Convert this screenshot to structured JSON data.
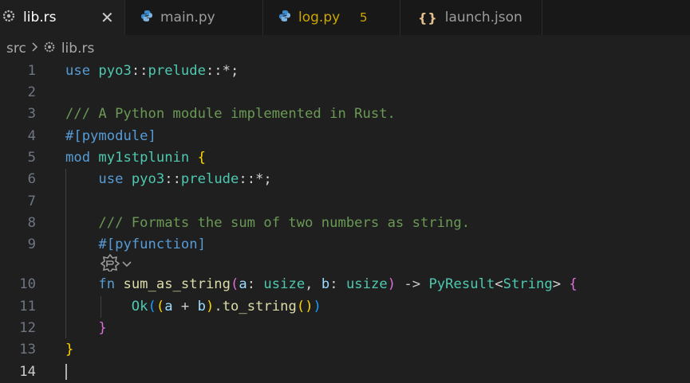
{
  "tabs": [
    {
      "label": "lib.rs",
      "icon": "gear-icon",
      "active": true,
      "close": "✕"
    },
    {
      "label": "main.py",
      "icon": "python-icon",
      "active": false
    },
    {
      "label": "log.py",
      "icon": "python-icon",
      "active": false,
      "badge": "5",
      "label_color": "#cca700"
    },
    {
      "label": "launch.json",
      "icon": "curly-braces-icon",
      "active": false,
      "glyph": "{}"
    }
  ],
  "breadcrumb": {
    "folder": "src",
    "file": "lib.rs"
  },
  "editor": {
    "line_numbers": [
      "1",
      "2",
      "3",
      "4",
      "5",
      "6",
      "7",
      "8",
      "9",
      "10",
      "11",
      "12",
      "13",
      "14"
    ],
    "current_line": "14",
    "lines": [
      [
        {
          "t": "use",
          "c": "k"
        },
        {
          "t": " "
        },
        {
          "t": "pyo3",
          "c": "t"
        },
        {
          "t": "::",
          "c": "w"
        },
        {
          "t": "prelude",
          "c": "t"
        },
        {
          "t": "::",
          "c": "w"
        },
        {
          "t": "*",
          "c": "w"
        },
        {
          "t": ";",
          "c": "w"
        }
      ],
      [],
      [
        {
          "t": "/// A Python module implemented in Rust.",
          "c": "c"
        }
      ],
      [
        {
          "t": "#[",
          "c": "k"
        },
        {
          "t": "pymodule",
          "c": "k"
        },
        {
          "t": "]",
          "c": "k"
        }
      ],
      [
        {
          "t": "mod",
          "c": "k"
        },
        {
          "t": " "
        },
        {
          "t": "my1stplunin",
          "c": "t"
        },
        {
          "t": " "
        },
        {
          "t": "{",
          "c": "y"
        }
      ],
      [
        {
          "t": "    "
        },
        {
          "t": "use",
          "c": "k"
        },
        {
          "t": " "
        },
        {
          "t": "pyo3",
          "c": "t"
        },
        {
          "t": "::",
          "c": "w"
        },
        {
          "t": "prelude",
          "c": "t"
        },
        {
          "t": "::",
          "c": "w"
        },
        {
          "t": "*",
          "c": "w"
        },
        {
          "t": ";",
          "c": "w"
        }
      ],
      [],
      [
        {
          "t": "    "
        },
        {
          "t": "/// Formats the sum of two numbers as string.",
          "c": "c"
        }
      ],
      [
        {
          "t": "    "
        },
        {
          "t": "#[",
          "c": "k"
        },
        {
          "t": "pyfunction",
          "c": "k"
        },
        {
          "t": "]",
          "c": "k"
        }
      ],
      [
        {
          "t": "    "
        },
        {
          "t": "fn",
          "c": "k"
        },
        {
          "t": " "
        },
        {
          "t": "sum_as_string",
          "c": "f"
        },
        {
          "t": "(",
          "c": "p"
        },
        {
          "t": "a",
          "c": "v"
        },
        {
          "t": ": "
        },
        {
          "t": "usize",
          "c": "t"
        },
        {
          "t": ", "
        },
        {
          "t": "b",
          "c": "v"
        },
        {
          "t": ": "
        },
        {
          "t": "usize",
          "c": "t"
        },
        {
          "t": ")",
          "c": "p"
        },
        {
          "t": " -> "
        },
        {
          "t": "PyResult",
          "c": "t"
        },
        {
          "t": "<",
          "c": "w"
        },
        {
          "t": "String",
          "c": "t"
        },
        {
          "t": ">",
          "c": "w"
        },
        {
          "t": " "
        },
        {
          "t": "{",
          "c": "p"
        }
      ],
      [
        {
          "t": "        "
        },
        {
          "t": "Ok",
          "c": "t"
        },
        {
          "t": "(",
          "c": "b"
        },
        {
          "t": "(",
          "c": "y"
        },
        {
          "t": "a",
          "c": "v"
        },
        {
          "t": " + "
        },
        {
          "t": "b",
          "c": "v"
        },
        {
          "t": ")",
          "c": "y"
        },
        {
          "t": "."
        },
        {
          "t": "to_string",
          "c": "f"
        },
        {
          "t": "()",
          "c": "y"
        },
        {
          "t": ")",
          "c": "b"
        }
      ],
      [
        {
          "t": "    "
        },
        {
          "t": "}",
          "c": "p"
        }
      ],
      [
        {
          "t": "}",
          "c": "y"
        }
      ],
      []
    ],
    "codelens_icon": "rust-analyzer-icon"
  }
}
